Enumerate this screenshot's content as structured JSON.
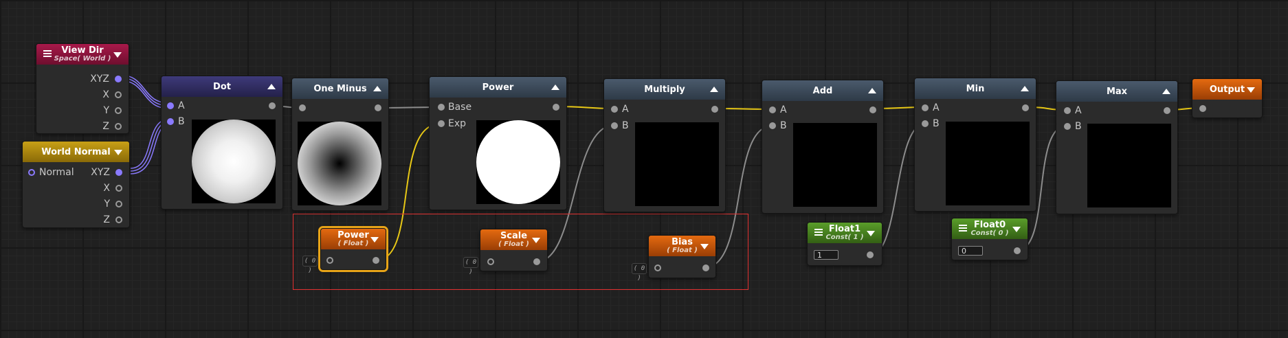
{
  "colors": {
    "wire_float": "#e8c816",
    "wire_gray": "#8c8c8c",
    "wire_vector": "#8a7aff",
    "selection_box": "#e23030",
    "selected_node": "#e8a418"
  },
  "nodes": {
    "view_dir": {
      "title": "View Dir",
      "subtitle": "Space( World )",
      "ports": [
        "XYZ",
        "X",
        "Y",
        "Z"
      ]
    },
    "world_normal": {
      "title": "World Normal",
      "input": "Normal",
      "ports": [
        "XYZ",
        "X",
        "Y",
        "Z"
      ]
    },
    "dot": {
      "title": "Dot",
      "inputs": [
        "A",
        "B"
      ]
    },
    "one_minus": {
      "title": "One Minus"
    },
    "power": {
      "title": "Power",
      "inputs": [
        "Base",
        "Exp"
      ]
    },
    "multiply": {
      "title": "Multiply",
      "inputs": [
        "A",
        "B"
      ]
    },
    "add": {
      "title": "Add",
      "inputs": [
        "A",
        "B"
      ]
    },
    "min": {
      "title": "Min",
      "inputs": [
        "A",
        "B"
      ]
    },
    "max": {
      "title": "Max",
      "inputs": [
        "A",
        "B"
      ]
    },
    "output": {
      "title": "Output"
    },
    "power_param": {
      "title": "Power",
      "subtitle": "( Float )",
      "tag": "( 0 )"
    },
    "scale_param": {
      "title": "Scale",
      "subtitle": "( Float )",
      "tag": "( 0 )"
    },
    "bias_param": {
      "title": "Bias",
      "subtitle": "( Float )",
      "tag": "( 0 )"
    },
    "float1": {
      "title": "Float1",
      "subtitle": "Const( 1 )",
      "value": "1"
    },
    "float0": {
      "title": "Float0",
      "subtitle": "Const( 0 )",
      "value": "0"
    }
  }
}
